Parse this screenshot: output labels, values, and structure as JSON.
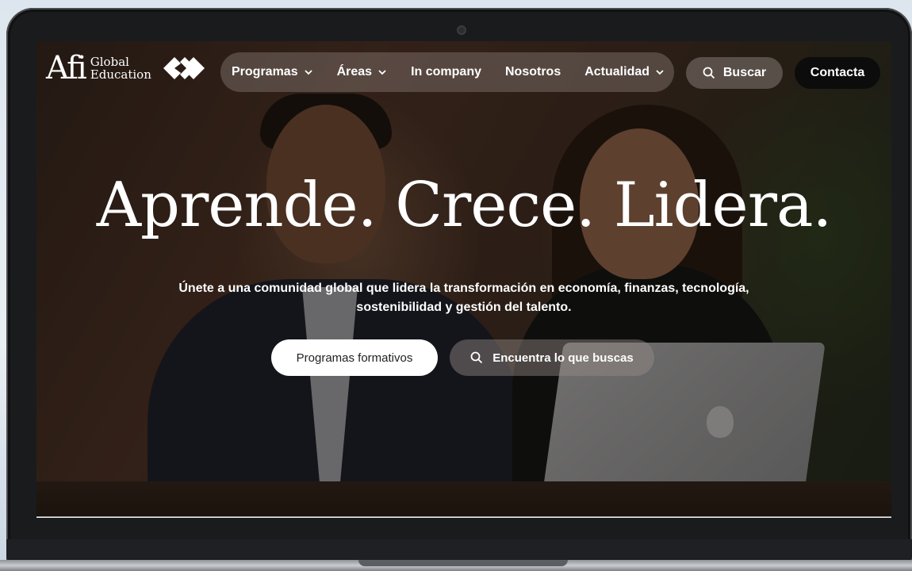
{
  "logo": {
    "mark": "Afi",
    "line1": "Global",
    "line2": "Education"
  },
  "nav": {
    "items": [
      {
        "label": "Programas",
        "has_dropdown": true
      },
      {
        "label": "Áreas",
        "has_dropdown": true
      },
      {
        "label": "In company",
        "has_dropdown": false
      },
      {
        "label": "Nosotros",
        "has_dropdown": false
      },
      {
        "label": "Actualidad",
        "has_dropdown": true
      }
    ],
    "search_label": "Buscar",
    "contact_label": "Contacta"
  },
  "hero": {
    "title": "Aprende. Crece. Lidera.",
    "subtitle": "Únete a una comunidad global que lidera la transformación en economía, finanzas, tecnología, sostenibilidad y gestión del talento.",
    "primary_cta": "Programas formativos",
    "secondary_cta": "Encuentra lo que buscas"
  },
  "icons": {
    "search": "search-icon",
    "chevron": "chevron-down-icon",
    "brand": "afi-logo-mark"
  }
}
